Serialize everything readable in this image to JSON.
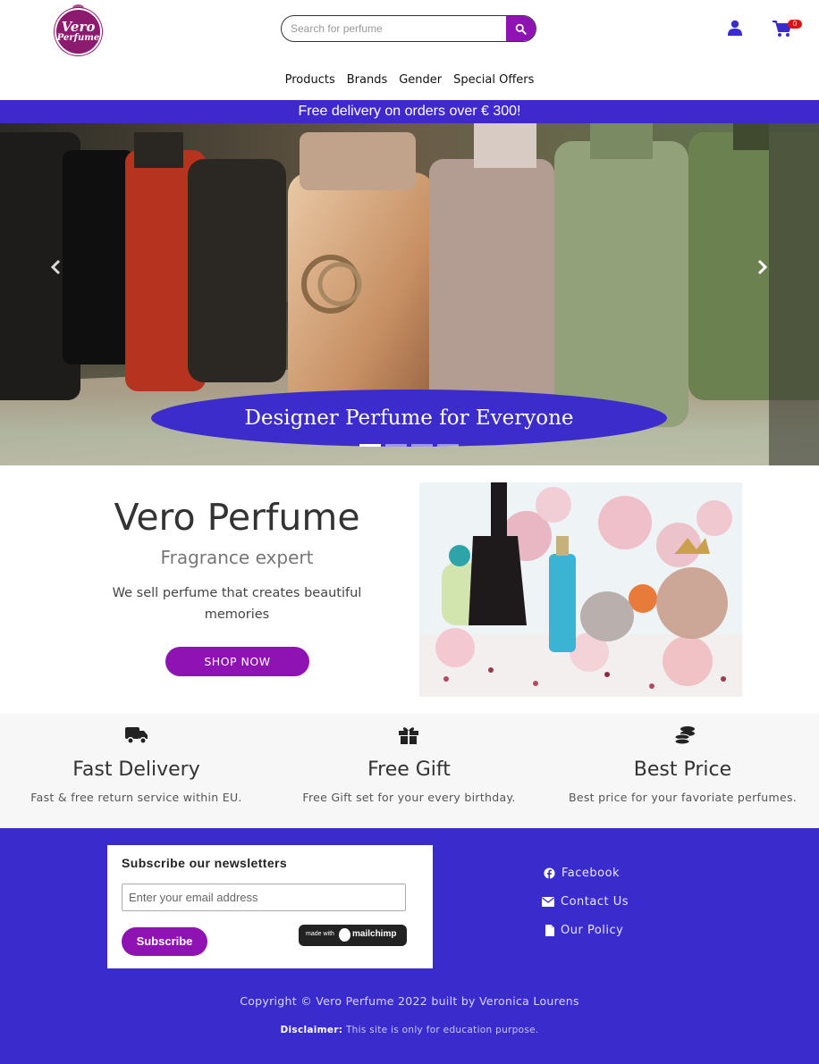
{
  "header": {
    "logo": {
      "line1": "Vero",
      "line2": "Perfume"
    },
    "search": {
      "placeholder": "Search for perfume"
    },
    "cart_count": "0"
  },
  "nav": [
    {
      "label": "Products"
    },
    {
      "label": "Brands"
    },
    {
      "label": "Gender"
    },
    {
      "label": "Special Offers"
    }
  ],
  "banner": {
    "text": "Free delivery on orders over € 300!"
  },
  "carousel": {
    "caption": "Designer Perfume for Everyone",
    "slide_count": 4,
    "active_slide": 1
  },
  "about": {
    "title": "Vero Perfume",
    "subtitle": "Fragrance expert",
    "text": "We sell perfume that creates beautiful memories",
    "button": "SHOP NOW"
  },
  "features": [
    {
      "icon": "truck-icon",
      "title": "Fast Delivery",
      "text": "Fast & free return service within EU."
    },
    {
      "icon": "gift-icon",
      "title": "Free Gift",
      "text": "Free Gift set for your every birthday."
    },
    {
      "icon": "coins-icon",
      "title": "Best Price",
      "text": "Best price for your favoriate perfumes."
    }
  ],
  "footer": {
    "newsletter": {
      "title": "Subscribe our newsletters",
      "placeholder": "Enter your email address",
      "button": "Subscribe",
      "badge_made": "made with",
      "badge_brand": "mailchimp"
    },
    "links": [
      {
        "icon": "facebook-icon",
        "label": "Facebook"
      },
      {
        "icon": "envelope-icon",
        "label": "Contact Us"
      },
      {
        "icon": "file-icon",
        "label": "Our Policy"
      }
    ],
    "copyright": "Copyright © Vero Perfume 2022 built by Veronica Lourens",
    "disclaimer_label": "Disclaimer:",
    "disclaimer_text": "This site is only for education purpose."
  },
  "colors": {
    "accent": "#8f12b3",
    "primary": "#3a2ccc",
    "logo": "#8c1a6e"
  }
}
